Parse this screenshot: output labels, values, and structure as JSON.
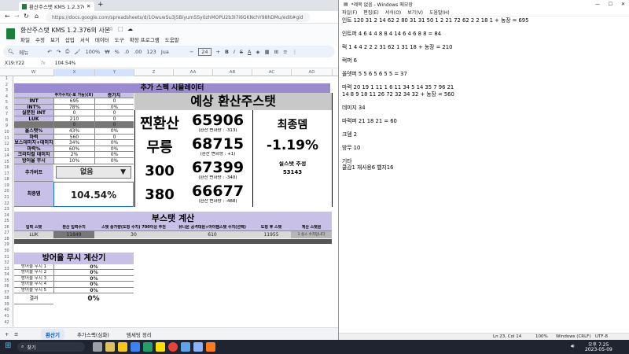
{
  "browser": {
    "tab_title": "환산주스탯 KMS 1.2.376의 사본",
    "url": "https://docs.google.com/spreadsheets/d/1OwuwSu3j5Biyum5Sy0zhMOPU2b3I7i6GKNchY98hDMu/edit#gid=1397551479"
  },
  "sheet": {
    "title": "환산주스탯 KMS 1.2.376의 사본",
    "menu": [
      "파일",
      "수정",
      "보기",
      "삽입",
      "서식",
      "데이터",
      "도구",
      "확장 프로그램",
      "도움말"
    ],
    "toolbar": {
      "search": "메뉴",
      "zoom": "100%",
      "currency": "₩",
      "percent": "%",
      "decimals": ".0",
      "decimals2": ".00",
      "number": "123",
      "font": "Jua",
      "font_size": "24"
    },
    "name_box": "X19:Y22",
    "formula": "104.54%",
    "columns": [
      "W",
      "X",
      "Y",
      "Z",
      "AA",
      "AB",
      "AC",
      "AD"
    ],
    "rows": [
      "1",
      "2",
      "3",
      "4",
      "5",
      "6",
      "7",
      "8",
      "9",
      "10",
      "11",
      "12",
      "13",
      "14",
      "15",
      "16",
      "17",
      "18",
      "19",
      "20",
      "21",
      "22",
      "23",
      "24",
      "25",
      "26",
      "27",
      "28",
      "29",
      "30",
      "31",
      "32",
      "33",
      "34",
      "35",
      "36",
      "37",
      "38",
      "39",
      "40",
      "41",
      "42"
    ],
    "sim": {
      "title": "추가 스펙 시뮬레이터",
      "col_a": "추가수치(-로 가능)(X)",
      "col_b": "증가치",
      "rows": [
        {
          "label": "INT",
          "a": "695",
          "b": "0"
        },
        {
          "label": "INT%",
          "a": "78%",
          "b": "0%"
        },
        {
          "label": "실분된 INT",
          "a": "0",
          "b": "0"
        },
        {
          "label": "LUK",
          "a": "210",
          "b": "0"
        },
        {
          "label": "",
          "a": "0",
          "b": "0"
        },
        {
          "label": "올스탯%",
          "a": "43%",
          "b": "0%"
        },
        {
          "label": "마력",
          "a": "560",
          "b": "0"
        },
        {
          "label": "보스데미지+데미지",
          "a": "34%",
          "b": "0%"
        },
        {
          "label": "마력%",
          "a": "60%",
          "b": "0%"
        },
        {
          "label": "크리티컬 데미지",
          "a": "2%",
          "b": "0%"
        },
        {
          "label": "방어율 무시",
          "a": "10%",
          "b": "0%"
        }
      ],
      "buff_label": "추가버프",
      "buff_value": "없음",
      "final_label": "최종뎀",
      "final_value": "104.54%"
    },
    "expected": {
      "title": "예상 환산주스탯",
      "rows": [
        {
          "name": "찐환산",
          "value": "65906",
          "sub": "(환산 변화량 : -313)"
        },
        {
          "name": "무릉",
          "value": "68715",
          "sub": "(환산 변화량 : +1)"
        },
        {
          "name": "300",
          "value": "67399",
          "sub": "(환산 변화량 : -340)"
        },
        {
          "name": "380",
          "value": "66677",
          "sub": "(환산 변화량 : -488)"
        }
      ],
      "final_title": "최종뎀",
      "final_value": "-1.19%",
      "stat_title": "실스탯 추정",
      "stat_value": "53143"
    },
    "boost": {
      "title": "부스탯 계산",
      "headers": [
        "입력 스탯",
        "환산 입력수치",
        "스탯 증가량(도핑 수치) 700이상 추천",
        "유니온 공격대원+아이템스탯 수치(선택)",
        "도핑 후 스탯",
        "계산 스탯원"
      ],
      "row": [
        "LUK",
        "11849",
        "30",
        "610",
        "11955",
        "1 실스 수치입니다"
      ]
    },
    "armor": {
      "title": "방어율 무시 계산기",
      "rows": [
        {
          "label": "방어율 무시 1",
          "value": "0%"
        },
        {
          "label": "방어율 무시 2",
          "value": "0%"
        },
        {
          "label": "방어율 무시 3",
          "value": "0%"
        },
        {
          "label": "방어율 무시 4",
          "value": "0%"
        },
        {
          "label": "방어율 무시 5",
          "value": "0%"
        }
      ],
      "result_label": "결과",
      "result_value": "0%"
    },
    "tabs": [
      "환산기",
      "추가스펙(심화)",
      "템세팅 정리"
    ]
  },
  "notepad": {
    "title": "*제목 없음 - Windows 메모장",
    "menu": [
      "파일(F)",
      "편집(E)",
      "서식(O)",
      "보기(V)",
      "도움말(H)"
    ],
    "lines": [
      "인트 120 31 2 14 62 2 80 31 31 50 1 2 21 72 62 2 2 18 1 + 농장 = 695",
      "",
      "인트퍼 4 6 4 4 8 8 4 14 6 4 6 8 8 = 84",
      "",
      "럭 1 4 4 2 2 2 31 62 1 31 18 + 농장 = 210",
      "",
      "럭퍼 6",
      "",
      "올뎃퍼 5 5 6 5 6 5 5 = 37",
      "",
      "마력 20 19 1 11 1 6 11 34 5 14 35 7 96 21",
      "14 8 9 18 11 26 72 32 34 32 + 농장 = 560",
      "",
      "데미지 34",
      "",
      "마력퍼 21 18 21 = 60",
      "",
      "크뎀 2",
      "",
      "방무 10",
      "",
      "기타",
      "쿨감1 재사용6 벨지16"
    ],
    "status": {
      "pos": "Ln 23, Col 14",
      "zoom": "100%",
      "eol": "Windows (CRLF)",
      "enc": "UTF-8"
    }
  },
  "taskbar": {
    "search": "찾기",
    "time": "오후 7:25",
    "date": "2023-05-09"
  },
  "colors": {
    "purple_header": "#9a8bd0",
    "label_bg": "#c9c0e8",
    "grey": "#b7b7b7"
  }
}
